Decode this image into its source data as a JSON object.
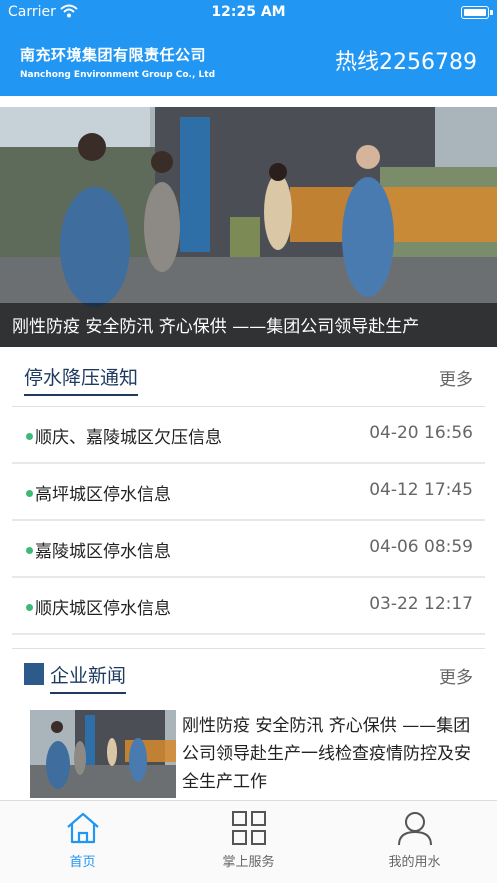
{
  "status_bar": {
    "carrier": "Carrier",
    "time": "12:25 AM"
  },
  "header": {
    "company_cn": "南充环境集团有限责任公司",
    "company_en": "Nanchong Environment Group Co., Ltd",
    "hotline": "热线2256789"
  },
  "banner": {
    "caption": "刚性防疫 安全防汛 齐心保供 ——集团公司领导赴生产"
  },
  "notices": {
    "title": "停水降压通知",
    "more": "更多",
    "items": [
      {
        "text": "顺庆、嘉陵城区欠压信息",
        "date": "04-20 16:56"
      },
      {
        "text": "高坪城区停水信息",
        "date": "04-12 17:45"
      },
      {
        "text": "嘉陵城区停水信息",
        "date": "04-06 08:59"
      },
      {
        "text": "顺庆城区停水信息",
        "date": "03-22 12:17"
      }
    ]
  },
  "news": {
    "title": "企业新闻",
    "more": "更多",
    "items": [
      {
        "headline": "刚性防疫 安全防汛 齐心保供 ——集团公司领导赴生产一线检查疫情防控及安全生产工作"
      }
    ]
  },
  "tabbar": {
    "items": [
      {
        "label": "首页",
        "icon": "home-icon",
        "active": true
      },
      {
        "label": "掌上服务",
        "icon": "grid-icon",
        "active": false
      },
      {
        "label": "我的用水",
        "icon": "user-icon",
        "active": false
      }
    ]
  },
  "colors": {
    "primary": "#2196f3",
    "section_title": "#1e3a5f",
    "dot": "#3cb878"
  }
}
